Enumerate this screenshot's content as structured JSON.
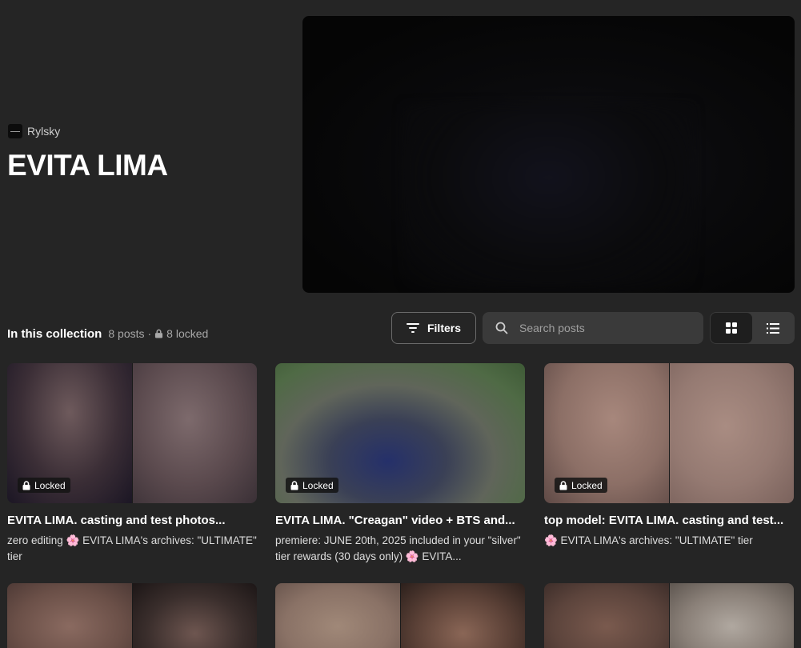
{
  "creator": {
    "name": "Rylsky"
  },
  "collection": {
    "title": "EVITA LIMA",
    "section_label": "In this collection",
    "post_count": "8 posts",
    "separator": "·",
    "locked_count": "8 locked"
  },
  "toolbar": {
    "filters_label": "Filters",
    "search_placeholder": "Search posts",
    "view_mode": "grid"
  },
  "posts": [
    {
      "title": "EVITA LIMA. casting and test photos...",
      "description": "zero editing 🌸 EVITA LIMA's archives: \"ULTIMATE\" tier",
      "badge": "Locked"
    },
    {
      "title": "EVITA LIMA. \"Creagan\" video + BTS and...",
      "description": "premiere: JUNE 20th, 2025 included in your \"silver\" tier rewards (30 days only) 🌸 EVITA...",
      "badge": "Locked"
    },
    {
      "title": "top model: EVITA LIMA. casting and test...",
      "description": "🌸 EVITA LIMA's archives: \"ULTIMATE\" tier",
      "badge": "Locked"
    }
  ],
  "colors": {
    "background": "#252525",
    "surface": "#3a3a3a",
    "text": "#ffffff",
    "muted_text": "#a8a8a8"
  }
}
